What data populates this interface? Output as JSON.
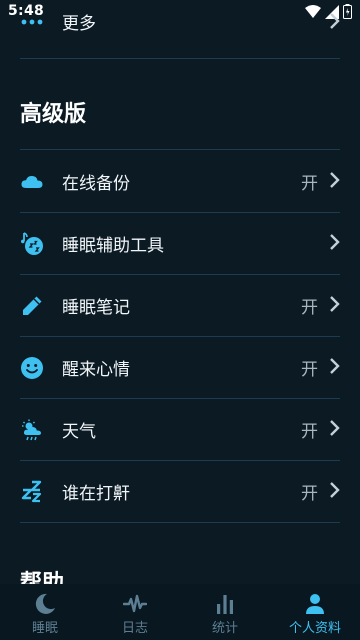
{
  "status_bar": {
    "time": "5:48"
  },
  "top_row": {
    "label": "更多"
  },
  "section_title": "高级版",
  "premium_items": [
    {
      "label": "在线备份",
      "value": "开",
      "icon": "cloud-icon"
    },
    {
      "label": "睡眠辅助工具",
      "value": "",
      "icon": "music-sleep-icon"
    },
    {
      "label": "睡眠笔记",
      "value": "开",
      "icon": "pencil-icon"
    },
    {
      "label": "醒来心情",
      "value": "开",
      "icon": "smiley-icon"
    },
    {
      "label": "天气",
      "value": "开",
      "icon": "weather-icon"
    },
    {
      "label": "谁在打鼾",
      "value": "开",
      "icon": "snore-zzz-icon"
    }
  ],
  "help_title": "帮助",
  "bottom_nav": [
    {
      "label": "睡眠",
      "icon": "moon-icon",
      "active": false
    },
    {
      "label": "日志",
      "icon": "pulse-icon",
      "active": false
    },
    {
      "label": "统计",
      "icon": "bar-chart-icon",
      "active": false
    },
    {
      "label": "个人资料",
      "icon": "person-icon",
      "active": true
    }
  ],
  "colors": {
    "background": "#0c1a24",
    "accent": "#3ec0f0",
    "divider": "#1e3c4f",
    "nav_inactive": "#5d7f93"
  }
}
